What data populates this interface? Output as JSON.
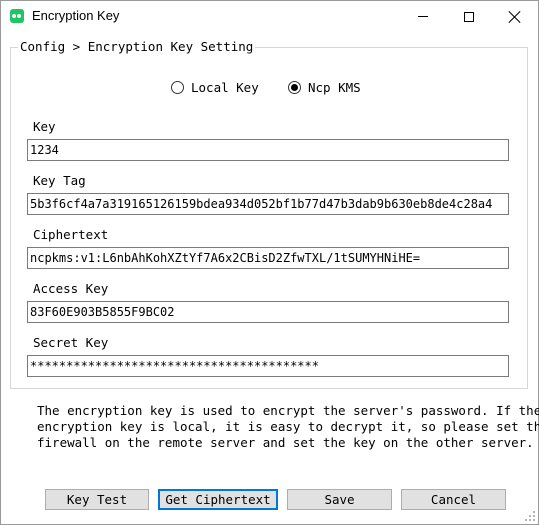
{
  "window": {
    "title": "Encryption Key",
    "accent_color": "#1ec564"
  },
  "group": {
    "legend": "Config > Encryption Key Setting"
  },
  "key_source": {
    "options": [
      {
        "label": "Local Key",
        "checked": false
      },
      {
        "label": "Ncp KMS",
        "checked": true
      }
    ]
  },
  "fields": {
    "key": {
      "label": "Key",
      "value": "1234"
    },
    "key_tag": {
      "label": "Key Tag",
      "value": "5b3f6cf4a7a319165126159bdea934d052bf1b77d47b3dab9b630eb8de4c28a4"
    },
    "ciphertext": {
      "label": "Ciphertext",
      "value": "ncpkms:v1:L6nbAhKohXZtYf7A6x2CBisD2ZfwTXL/1tSUMYHNiHE="
    },
    "access_key": {
      "label": "Access Key",
      "value": "83F60E903B5855F9BC02"
    },
    "secret_key": {
      "label": "Secret Key",
      "value": "****************************************"
    }
  },
  "description": {
    "lines": [
      "The encryption key is used to encrypt the server's password. If the",
      "encryption key is local, it is easy to decrypt it, so please set the",
      "firewall on the remote server and set the key on the other server."
    ]
  },
  "buttons": {
    "key_test": "Key Test",
    "get_ciphertext": "Get Ciphertext",
    "save": "Save",
    "cancel": "Cancel"
  }
}
